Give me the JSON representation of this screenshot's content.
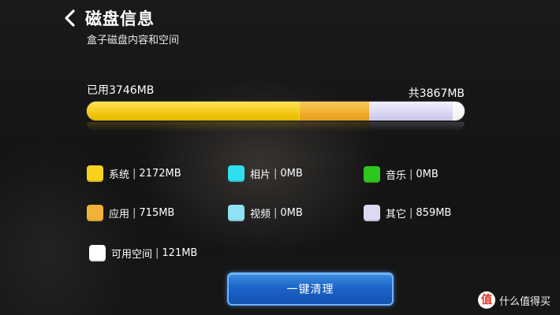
{
  "header": {
    "title": "磁盘信息",
    "subtitle": "盒子磁盘内容和空间"
  },
  "storage": {
    "used_label": "已用3746MB",
    "total_label": "共3867MB",
    "total_mb": 3867,
    "segments": [
      {
        "key": "system",
        "value_mb": 2172,
        "color": "#f3c813"
      },
      {
        "key": "apps",
        "value_mb": 715,
        "color": "#efae2a"
      },
      {
        "key": "other",
        "value_mb": 859,
        "color": "#d9d6f2"
      },
      {
        "key": "free",
        "value_mb": 121,
        "color": "#ffffff"
      }
    ]
  },
  "legend": {
    "system": {
      "name": "系统",
      "value": "2172MB",
      "color": "#f7d21a"
    },
    "photos": {
      "name": "相片",
      "value": "0MB",
      "color": "#2fdff0"
    },
    "music": {
      "name": "音乐",
      "value": "0MB",
      "color": "#2ec71e"
    },
    "apps": {
      "name": "应用",
      "value": "715MB",
      "color": "#f2b23a"
    },
    "video": {
      "name": "视频",
      "value": "0MB",
      "color": "#8ee2f5"
    },
    "other": {
      "name": "其它",
      "value": "859MB",
      "color": "#dcdaf2"
    },
    "free": {
      "name": "可用空间",
      "value": "121MB",
      "color": "#ffffff"
    },
    "separator": "|"
  },
  "actions": {
    "clean_label": "一键清理"
  },
  "watermark": {
    "logo_char": "值",
    "text": "什么值得买"
  }
}
